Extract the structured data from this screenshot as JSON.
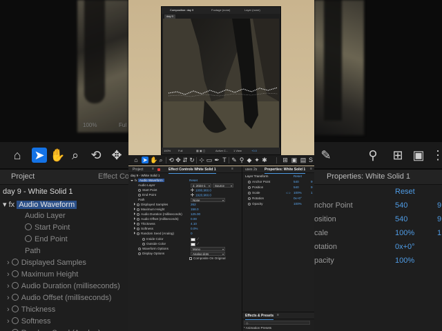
{
  "background": {
    "left": {
      "zoom": "100%",
      "resolution": "Ful",
      "tabs": [
        "Project",
        "Effect Cont"
      ],
      "layer_title": "day 9 - White Solid 1",
      "rows": [
        {
          "label": "Audio Waveform",
          "kind": "effect"
        },
        {
          "label": "Audio Layer",
          "kind": "plain"
        },
        {
          "label": "Start Point",
          "kind": "stopwatch"
        },
        {
          "label": "End Point",
          "kind": "stopwatch"
        },
        {
          "label": "Path",
          "kind": "plain"
        },
        {
          "label": "Displayed Samples",
          "kind": "twirl"
        },
        {
          "label": "Maximum Height",
          "kind": "twirl"
        },
        {
          "label": "Audio Duration (milliseconds)",
          "kind": "twirl"
        },
        {
          "label": "Audio Offset (milliseconds)",
          "kind": "twirl"
        },
        {
          "label": "Thickness",
          "kind": "twirl"
        },
        {
          "label": "Softness",
          "kind": "twirl"
        },
        {
          "label": "Random Seed (Analog)",
          "kind": "twirl"
        }
      ]
    },
    "right": {
      "tab": "Properties: White Solid 1",
      "reset": "Reset",
      "rows": [
        {
          "label": "nchor Point",
          "value": "540",
          "value2": "9"
        },
        {
          "label": "osition",
          "value": "540",
          "value2": "9"
        },
        {
          "label": "cale",
          "value": "100%",
          "value2": "1"
        },
        {
          "label": "otation",
          "value": "0x+0°",
          "value2": ""
        },
        {
          "label": "pacity",
          "value": "100%",
          "value2": ""
        }
      ]
    }
  },
  "monitor": {
    "tabs": [
      "Composition: day 9",
      "Footage (none)",
      "Layer (none)"
    ],
    "chip": "day 9",
    "bottom": {
      "zoom": "100%",
      "res": "Full",
      "camera": "Active C...",
      "views": "1 View",
      "plus": "+0.0"
    }
  },
  "effect_controls": {
    "tabs": {
      "project": "Project",
      "effect": "Effect Controls White Solid 1"
    },
    "layer_title": "day 9 - White Solid 1",
    "effect_name": "Audio Waveform",
    "reset": "Reset",
    "audio_layer": {
      "label": "Audio Layer",
      "layer_value": "2. 2024-1",
      "source_value": "Source"
    },
    "start_point": {
      "label": "Start Point",
      "value": "1080,960.0"
    },
    "end_point": {
      "label": "End Point",
      "value": "1920,960.0"
    },
    "path": {
      "label": "Path",
      "value": "None"
    },
    "params": [
      {
        "label": "Displayed Samples",
        "value": "262"
      },
      {
        "label": "Maximum Height",
        "value": "158.0"
      },
      {
        "label": "Audio Duration (milliseconds)",
        "value": "125.00"
      },
      {
        "label": "Audio Offset (milliseconds)",
        "value": "0.00"
      },
      {
        "label": "Thickness",
        "value": "4.10"
      },
      {
        "label": "Softness",
        "value": "0.0%"
      },
      {
        "label": "Random Seed (Analog)",
        "value": "0"
      }
    ],
    "inside_color": {
      "label": "Inside Color",
      "color": "#ffffff"
    },
    "outside_color": {
      "label": "Outside Color",
      "color": "#ffffff"
    },
    "waveform_options": {
      "label": "Waveform Options",
      "value": "Mono"
    },
    "display_options": {
      "label": "Display Options",
      "value": "Analog dots"
    },
    "composite": {
      "label": "Composite On Original"
    }
  },
  "properties": {
    "tabs": {
      "left": "uses 2s",
      "active": "Properties: White Solid 1"
    },
    "section": "Layer Transform",
    "reset": "Reset",
    "rows": [
      {
        "label": "Anchor Point",
        "value": "540",
        "value2": "9"
      },
      {
        "label": "Position",
        "value": "540",
        "value2": "9"
      },
      {
        "label": "Scale",
        "value": "100%",
        "value2": "1"
      },
      {
        "label": "Rotation",
        "value": "0x+0°",
        "value2": ""
      },
      {
        "label": "Opacity",
        "value": "100%",
        "value2": ""
      }
    ]
  },
  "effects_presets": {
    "tab": "Effects & Presets",
    "search_placeholder": "Q-",
    "first_item": "* Animation Presets"
  },
  "colors": {
    "accent": "#1473e6",
    "value_blue": "#5aa6ef",
    "panel": "#1f1f1f"
  }
}
